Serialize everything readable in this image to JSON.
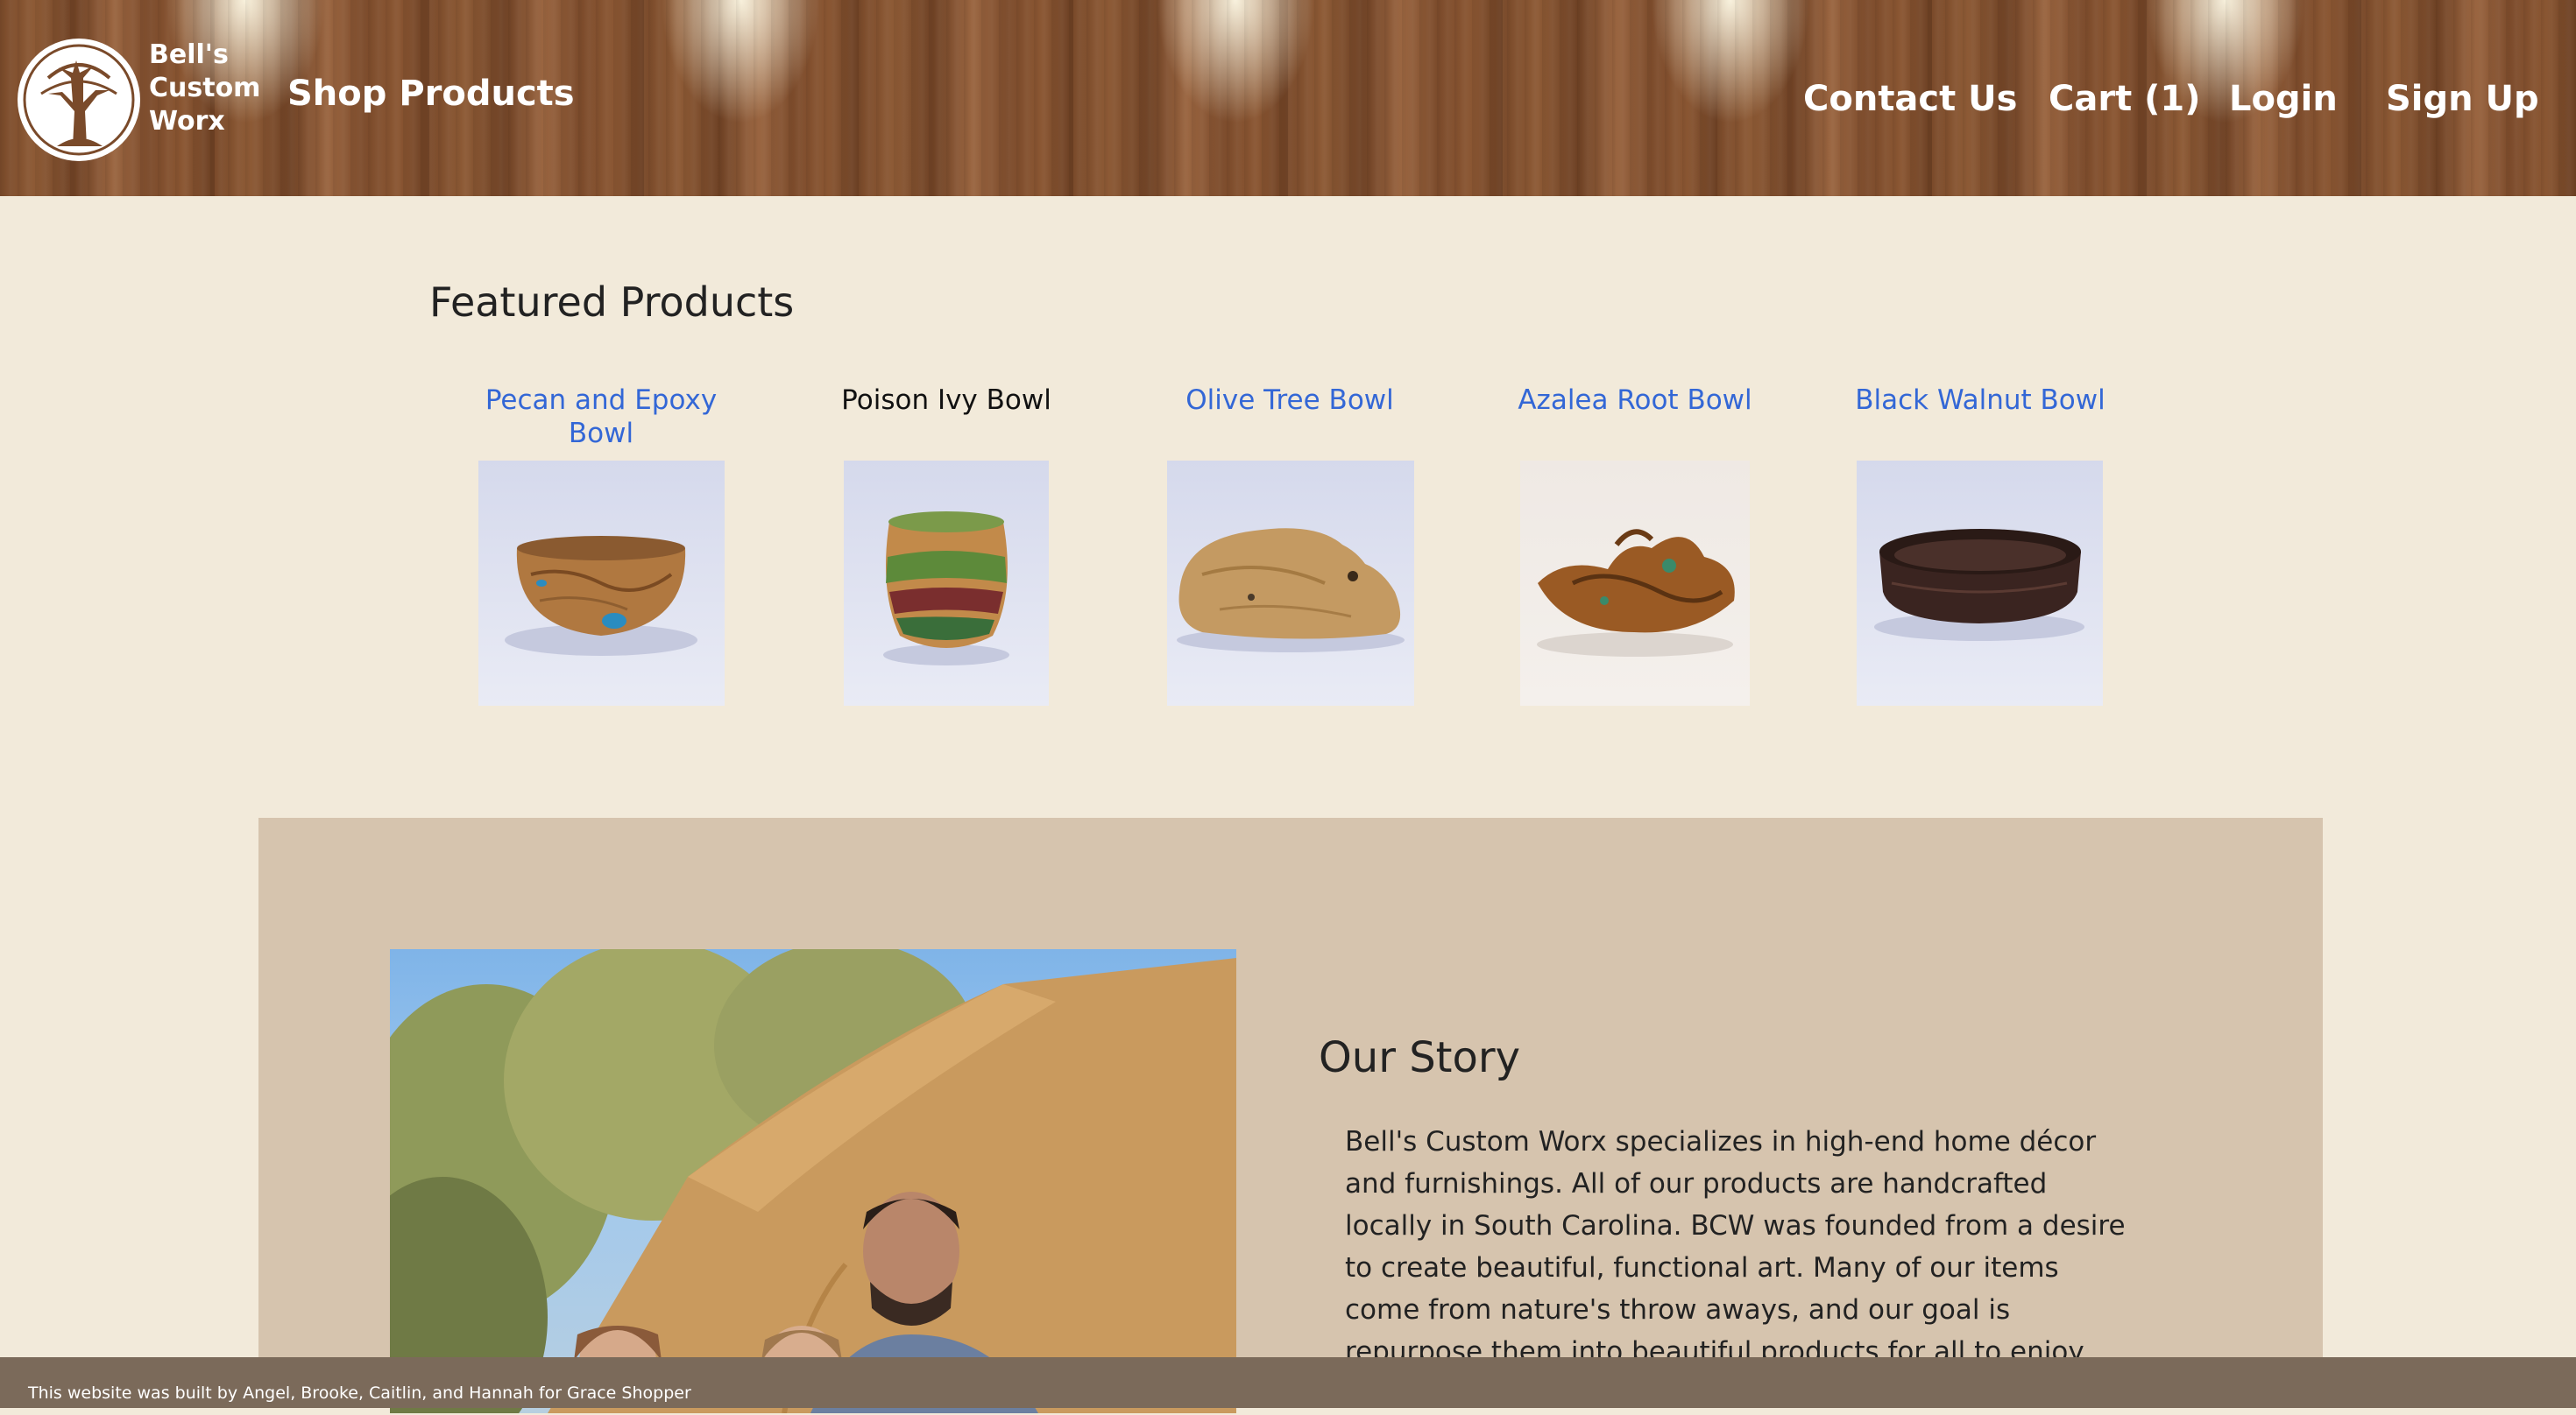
{
  "header": {
    "logo_lines": [
      "Bell's",
      "Custom",
      "Worx"
    ],
    "nav": {
      "shop": "Shop Products",
      "contact": "Contact Us",
      "cart": "Cart (1)",
      "login": "Login",
      "signup": "Sign Up"
    }
  },
  "featured": {
    "title": "Featured Products",
    "products": [
      {
        "name": "Pecan and Epoxy Bowl",
        "linked": true
      },
      {
        "name": "Poison Ivy Bowl",
        "linked": false
      },
      {
        "name": "Olive Tree Bowl",
        "linked": true
      },
      {
        "name": "Azalea Root Bowl",
        "linked": true
      },
      {
        "name": "Black Walnut Bowl",
        "linked": true
      }
    ]
  },
  "story": {
    "title": "Our Story",
    "text": "Bell's Custom Worx specializes in high-end home décor and furnishings. All of our products are handcrafted locally in South Carolina. BCW was founded from a desire to create beautiful, functional art. Many of our items come from nature's throw aways, and our goal is repurpose them into beautiful products for all to enjoy. Some of the materials we"
  },
  "footer": {
    "text": "This website was built by Angel, Brooke, Caitlin, and Hannah for Grace Shopper"
  },
  "colors": {
    "page_bg": "#f2eada",
    "story_bg": "#d6c4ae",
    "link": "#3367d6",
    "footer_bg": "#7b6a5a"
  }
}
